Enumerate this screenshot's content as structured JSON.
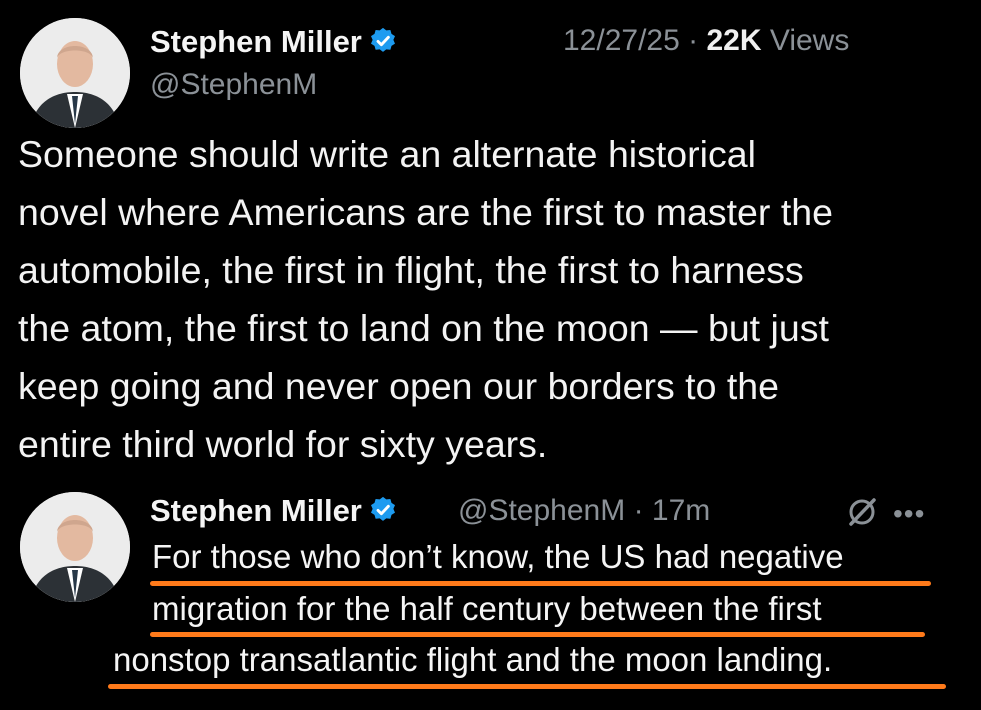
{
  "post": {
    "author_name": "Stephen Miller",
    "author_handle": "@StephenM",
    "date": "12/27/25",
    "separator": "·",
    "views_count": "22K",
    "views_label": "Views",
    "text": "Someone should write an alternate historical\nnovel where Americans are the first to master the\nautomobile, the first in flight, the first to harness\nthe atom, the first to land on the moon — but just\nkeep going and never open our borders to the\nentire third world for sixty years."
  },
  "reply": {
    "author_name": "Stephen Miller",
    "author_handle": "@StephenM",
    "separator": "·",
    "time": "17m",
    "lines": [
      "For those who don’t know, the US had negative",
      "migration for the half century between the first",
      "nonstop transatlantic flight and the moon  landing."
    ]
  },
  "icons": {
    "verified": "verified-badge-icon",
    "grok": "grok-icon",
    "more": "more-icon"
  },
  "colors": {
    "background": "#000000",
    "text": "#e7e9ea",
    "muted": "#8b9197",
    "verified": "#1d9bf0",
    "underline": "#ff7a1a"
  }
}
